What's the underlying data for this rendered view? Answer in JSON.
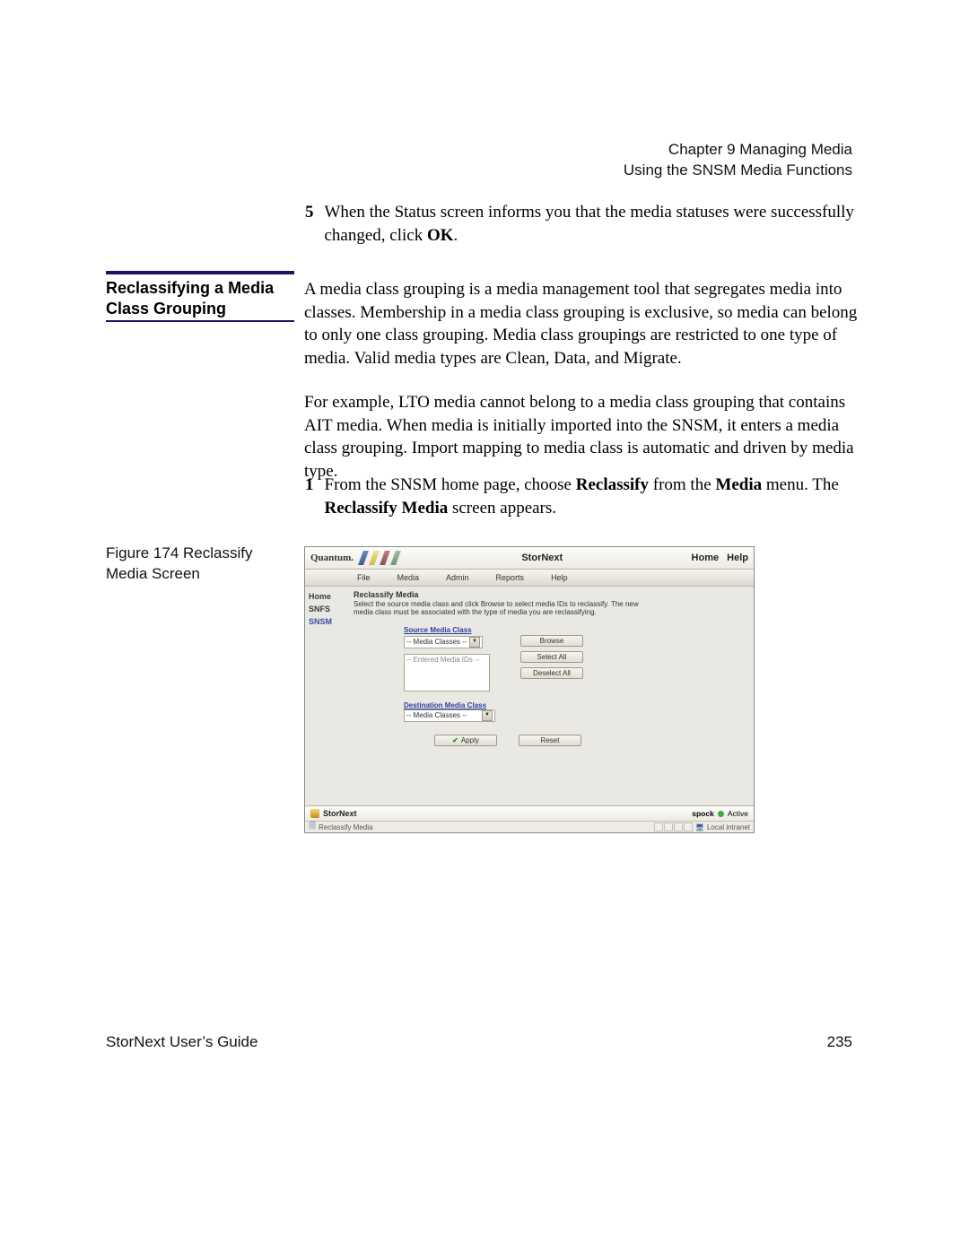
{
  "header": {
    "chapter": "Chapter 9  Managing Media",
    "subtitle": "Using the SNSM Media Functions"
  },
  "step5": {
    "num": "5",
    "text_a": "When the Status screen informs you that the media statuses were successfully changed, click ",
    "text_bold": "OK",
    "text_c": "."
  },
  "section": {
    "title_line1": "Reclassifying a Media",
    "title_line2": "Class Grouping"
  },
  "para_a": "A media class grouping is a media management tool that segregates media into classes. Membership in a media class grouping is exclusive, so media can belong to only one class grouping. Media class groupings are restricted to one type of media. Valid media types are Clean, Data, and Migrate.",
  "para_b": "For example, LTO media cannot belong to a media class grouping that contains AIT media. When media is initially imported into the SNSM, it enters a media class grouping. Import mapping to media class is automatic and driven by media type.",
  "step1": {
    "num": "1",
    "text_a": "From the SNSM home page, choose ",
    "bold1": "Reclassify",
    "text_b": " from the ",
    "bold2": "Media",
    "text_c": " menu. The ",
    "bold3": "Reclassify Media",
    "text_d": " screen appears."
  },
  "figure_caption": "Figure 174  Reclassify Media Screen",
  "screenshot": {
    "brand": "Quantum.",
    "app": "StorNext",
    "nav_home": "Home",
    "nav_help": "Help",
    "menu": {
      "file": "File",
      "media": "Media",
      "admin": "Admin",
      "reports": "Reports",
      "help": "Help"
    },
    "sidebar": {
      "home": "Home",
      "snfs": "SNFS",
      "snsm": "SNSM"
    },
    "main_title": "Reclassify Media",
    "main_desc": "Select the source media class and click Browse to select media IDs to reclassify. The new media class must be associated with the type of media you are reclassifying.",
    "src_label": "Source Media Class",
    "select_placeholder": "-- Media Classes --",
    "listbox_placeholder": "-- Entered Media IDs --",
    "btn_browse": "Browse",
    "btn_selectall": "Select All",
    "btn_deselectall": "Deselect All",
    "dest_label": "Destination Media Class",
    "btn_apply": "Apply",
    "btn_reset": "Reset",
    "footer_brand": "StorNext",
    "footer_host": "spock",
    "footer_status": "Active",
    "status_page": "Reclassify Media",
    "status_zone": "Local intranet"
  },
  "footer": {
    "guide": "StorNext User’s Guide",
    "page": "235"
  }
}
